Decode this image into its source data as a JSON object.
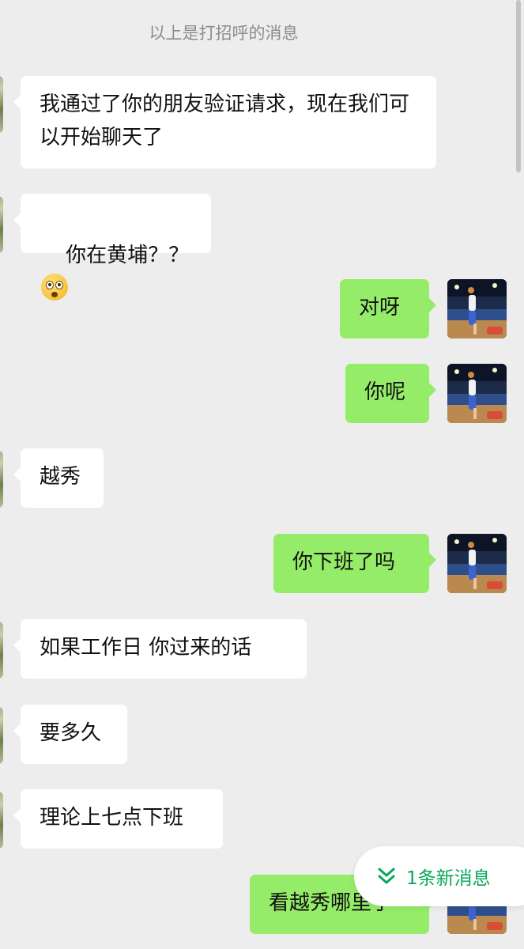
{
  "system_notice": "以上是打招呼的消息",
  "messages": [
    {
      "side": "in",
      "text": "我通过了你的朋友验证请求，现在我们可以开始聊天了"
    },
    {
      "side": "in",
      "text": "你在黄埔？？",
      "emoji": "astonished-face"
    },
    {
      "side": "out",
      "text": "对呀"
    },
    {
      "side": "out",
      "text": "你呢"
    },
    {
      "side": "in",
      "text": "越秀"
    },
    {
      "side": "out",
      "text": "你下班了吗"
    },
    {
      "side": "in",
      "text": "如果工作日 你过来的话"
    },
    {
      "side": "in",
      "text": "要多久"
    },
    {
      "side": "in",
      "text": "理论上七点下班"
    },
    {
      "side": "out",
      "text": "看越秀哪里了"
    }
  ],
  "new_message_pill": {
    "label": "1条新消息",
    "icon": "double-chevron-down-icon"
  },
  "colors": {
    "background": "#ededed",
    "incoming_bubble": "#ffffff",
    "outgoing_bubble": "#95ec69",
    "accent_green": "#07a85a",
    "system_text": "#8c8c8c"
  }
}
